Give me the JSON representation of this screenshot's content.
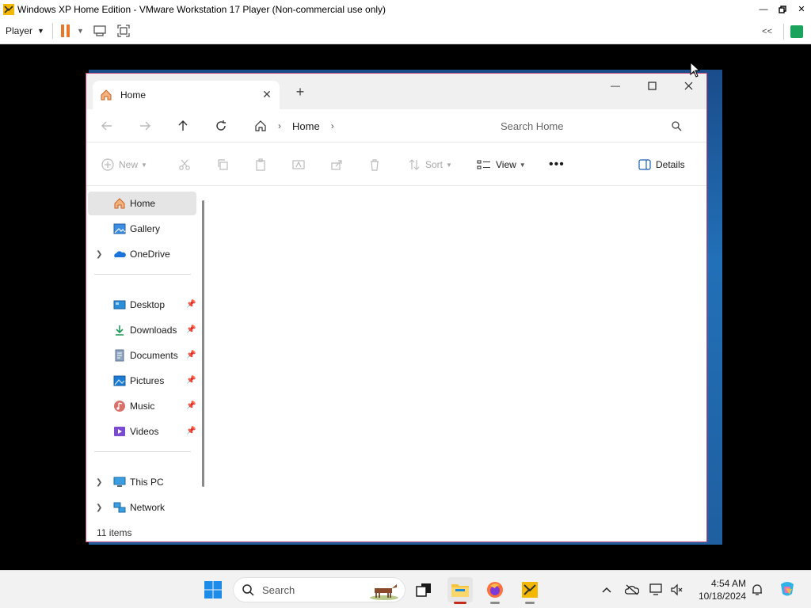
{
  "vm": {
    "title": "Windows XP Home Edition - VMware Workstation 17 Player (Non-commercial use only)",
    "player_menu": "Player",
    "window_controls": [
      "minimize",
      "restore",
      "close"
    ]
  },
  "explorer": {
    "tab_title": "Home",
    "breadcrumb": [
      "Home"
    ],
    "search_placeholder": "Search Home",
    "commands": {
      "new": "New",
      "sort": "Sort",
      "view": "View",
      "details": "Details"
    },
    "nav_items": [
      {
        "label": "Home",
        "icon": "home-icon",
        "selected": true,
        "expandable": false,
        "pinned": false
      },
      {
        "label": "Gallery",
        "icon": "gallery-icon",
        "selected": false,
        "expandable": false,
        "pinned": false
      },
      {
        "label": "OneDrive",
        "icon": "onedrive-icon",
        "selected": false,
        "expandable": true,
        "pinned": false
      },
      {
        "label": "Desktop",
        "icon": "desktop-folder-icon",
        "selected": false,
        "expandable": false,
        "pinned": true
      },
      {
        "label": "Downloads",
        "icon": "downloads-icon",
        "selected": false,
        "expandable": false,
        "pinned": true
      },
      {
        "label": "Documents",
        "icon": "documents-icon",
        "selected": false,
        "expandable": false,
        "pinned": true
      },
      {
        "label": "Pictures",
        "icon": "pictures-icon",
        "selected": false,
        "expandable": false,
        "pinned": true
      },
      {
        "label": "Music",
        "icon": "music-icon",
        "selected": false,
        "expandable": false,
        "pinned": true
      },
      {
        "label": "Videos",
        "icon": "videos-icon",
        "selected": false,
        "expandable": false,
        "pinned": true
      },
      {
        "label": "This PC",
        "icon": "this-pc-icon",
        "selected": false,
        "expandable": true,
        "pinned": false
      },
      {
        "label": "Network",
        "icon": "network-icon",
        "selected": false,
        "expandable": true,
        "pinned": false
      }
    ],
    "status": "11 items"
  },
  "taskbar": {
    "search_label": "Search",
    "time": "4:54 AM",
    "date": "10/18/2024"
  },
  "colors": {
    "accent_pause": "#e8792a",
    "window_border": "#c1467a",
    "selected_nav": "#e5e5e5",
    "taskbar_bg": "#f2f2f2"
  }
}
